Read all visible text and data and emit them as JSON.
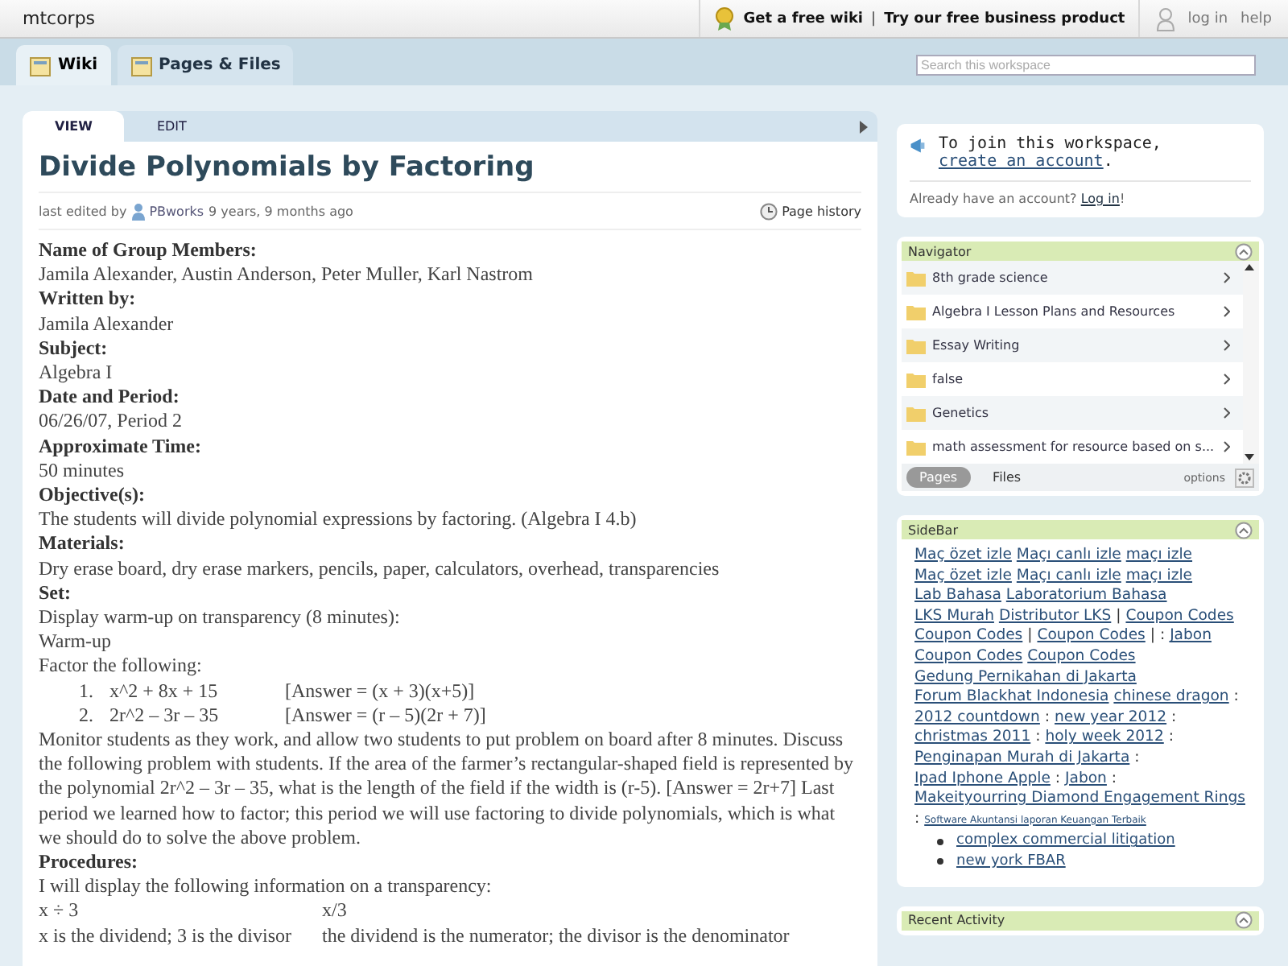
{
  "topbar": {
    "site": "mtcorps",
    "promo_links": [
      "Get a free wiki",
      "Try our free business product"
    ],
    "separator": "|",
    "account_links": [
      "log in",
      "help"
    ]
  },
  "tabs": [
    {
      "label": "Wiki",
      "selected": true
    },
    {
      "label": "Pages & Files",
      "selected": false
    }
  ],
  "search": {
    "placeholder": "Search this workspace"
  },
  "view_tabs": [
    {
      "label": "VIEW",
      "selected": true
    },
    {
      "label": "EDIT",
      "selected": false
    }
  ],
  "page": {
    "title": "Divide Polynomials by Factoring",
    "meta_prefix": "last edited by",
    "meta_user": "PBworks",
    "meta_time": "9 years, 9 months ago",
    "history_link": "Page history",
    "blocks": [
      {
        "kind": "heading",
        "text": "Name of Group Members:"
      },
      {
        "kind": "text",
        "text": "Jamila Alexander, Austin Anderson, Peter Muller, Karl Nastrom"
      },
      {
        "kind": "heading",
        "text": "Written by:"
      },
      {
        "kind": "text",
        "text": "Jamila Alexander"
      },
      {
        "kind": "heading",
        "text": "Subject:"
      },
      {
        "kind": "text",
        "text": "Algebra I"
      },
      {
        "kind": "heading",
        "text": "Date and Period:"
      },
      {
        "kind": "text",
        "text": "06/26/07, Period 2"
      },
      {
        "kind": "heading",
        "text": "Approximate Time:"
      },
      {
        "kind": "text",
        "text": "50 minutes"
      },
      {
        "kind": "heading",
        "text": "Objective(s):"
      },
      {
        "kind": "text",
        "text": "The students will divide polynomial expressions by factoring.  (Algebra I 4.b)"
      },
      {
        "kind": "heading",
        "text": "Materials:"
      },
      {
        "kind": "text",
        "text": "Dry erase board, dry erase markers, pencils, paper, calculators, overhead, transparencies"
      },
      {
        "kind": "heading",
        "text": "Set:"
      },
      {
        "kind": "text",
        "text": "Display warm-up on transparency (8 minutes):"
      },
      {
        "kind": "text",
        "text": "Warm-up"
      },
      {
        "kind": "text",
        "text": "Factor the following:"
      },
      {
        "kind": "list",
        "items": [
          {
            "number": "1.",
            "expr": "x^2 + 8x + 15",
            "answer": "[Answer = (x + 3)(x+5)]"
          },
          {
            "number": "2.",
            "expr": "2r^2 – 3r – 35",
            "answer": "[Answer = (r – 5)(2r + 7)]"
          }
        ]
      },
      {
        "kind": "text",
        "text": "Monitor students as they work, and allow two students to put problem on board after 8 minutes.  Discuss the following problem with students.  If the area of the farmer’s rectangular-shaped field is represented by the polynomial 2r^2 – 3r – 35, what is the length of the field if the width is (r-5).  [Answer = 2r+7]  Last period we learned how to factor; this period we will use factoring to divide polynomials, which is what we should do to solve the above problem."
      },
      {
        "kind": "heading",
        "text": "Procedures:"
      },
      {
        "kind": "text",
        "text": "I will display the following information on a transparency:"
      },
      {
        "kind": "pair",
        "left": "x ÷ 3",
        "right": "x/3"
      },
      {
        "kind": "pair",
        "left": "x is the dividend; 3 is the divisor",
        "right": "the dividend is the numerator; the divisor is the denominator"
      }
    ]
  },
  "join": {
    "prefix": "To join this workspace,",
    "link": "create an account",
    "suffix": ".",
    "question": "Already have an account?",
    "login": "Log in",
    "login_suffix": "!"
  },
  "navigator": {
    "title": "Navigator",
    "items": [
      "8th grade science",
      "Algebra I Lesson Plans and Resources",
      "Essay Writing",
      "false",
      "Genetics",
      "math assessment for resource based on s..."
    ],
    "tabs": [
      {
        "label": "Pages",
        "selected": true
      },
      {
        "label": "Files",
        "selected": false
      }
    ],
    "options": "options"
  },
  "sidebar": {
    "title": "SideBar",
    "tokens": [
      {
        "kind": "link",
        "text": "Maç özet izle"
      },
      {
        "kind": "link",
        "text": "Maçı canlı izle"
      },
      {
        "kind": "link",
        "text": "maçı izle"
      },
      {
        "kind": "link",
        "text": "Maç özet izle"
      },
      {
        "kind": "link",
        "text": "Maçı canlı izle"
      },
      {
        "kind": "link",
        "text": "maçı izle"
      },
      {
        "kind": "link",
        "text": "Lab Bahasa"
      },
      {
        "kind": "link",
        "text": "Laboratorium Bahasa"
      },
      {
        "kind": "link",
        "text": "LKS Murah"
      },
      {
        "kind": "link",
        "text": "Distributor LKS"
      },
      {
        "kind": "sep",
        "text": "|"
      },
      {
        "kind": "link",
        "text": "Coupon Codes"
      },
      {
        "kind": "link",
        "text": "Coupon Codes"
      },
      {
        "kind": "sep",
        "text": "|"
      },
      {
        "kind": "link",
        "text": "Coupon Codes"
      },
      {
        "kind": "sep",
        "text": "| :"
      },
      {
        "kind": "link",
        "text": "Jabon"
      },
      {
        "kind": "link",
        "text": "Coupon Codes"
      },
      {
        "kind": "link",
        "text": "Coupon Codes"
      },
      {
        "kind": "link",
        "text": "Gedung Pernikahan di Jakarta"
      },
      {
        "kind": "link",
        "text": "Forum Blackhat Indonesia"
      },
      {
        "kind": "link",
        "text": "chinese dragon"
      },
      {
        "kind": "sep",
        "text": ":"
      },
      {
        "kind": "link",
        "text": "2012 countdown"
      },
      {
        "kind": "sep",
        "text": ":"
      },
      {
        "kind": "link",
        "text": "new year 2012"
      },
      {
        "kind": "sep",
        "text": ":"
      },
      {
        "kind": "link",
        "text": "christmas 2011"
      },
      {
        "kind": "sep",
        "text": ":"
      },
      {
        "kind": "link",
        "text": "holy week 2012"
      },
      {
        "kind": "sep",
        "text": ":"
      },
      {
        "kind": "link",
        "text": "Penginapan Murah di Jakarta"
      },
      {
        "kind": "sep",
        "text": ":"
      },
      {
        "kind": "link",
        "text": "Ipad Iphone Apple"
      },
      {
        "kind": "sep",
        "text": ":"
      },
      {
        "kind": "link",
        "text": "Jabon"
      },
      {
        "kind": "sep",
        "text": ":"
      },
      {
        "kind": "link",
        "text": "Makeityourring Diamond Engagement Rings"
      },
      {
        "kind": "sep",
        "text": ":"
      },
      {
        "kind": "small",
        "text": "Software Akuntansi laporan Keuangan Terbaik"
      }
    ],
    "bullets": [
      "complex commercial litigation",
      "new york FBAR"
    ]
  },
  "recent": {
    "title": "Recent Activity"
  }
}
